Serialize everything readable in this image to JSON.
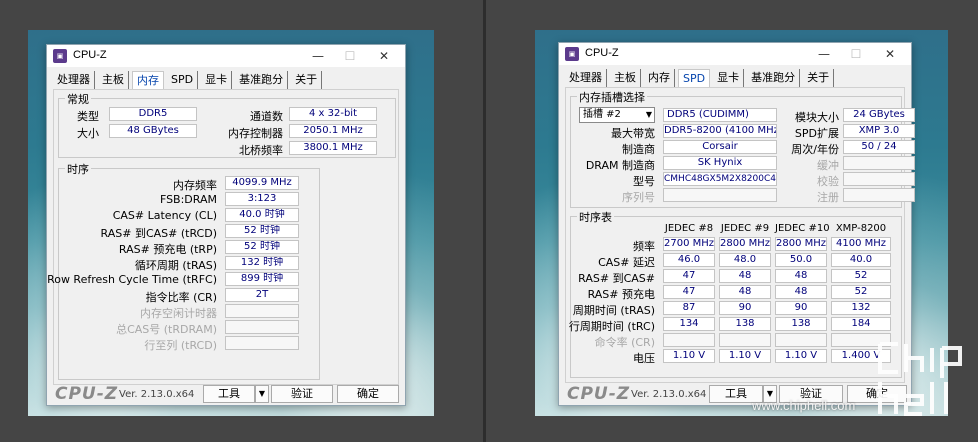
{
  "left": {
    "title": "CPU-Z",
    "tabs": [
      "处理器",
      "主板",
      "内存",
      "SPD",
      "显卡",
      "基准跑分",
      "关于"
    ],
    "active_tab": "内存",
    "general": {
      "group_label": "常规",
      "type_label": "类型",
      "type_value": "DDR5",
      "size_label": "大小",
      "size_value": "48 GBytes",
      "channels_label": "通道数",
      "channels_value": "4 x 32-bit",
      "mc_label": "内存控制器",
      "mc_value": "2050.1 MHz",
      "nb_label": "北桥频率",
      "nb_value": "3800.1 MHz"
    },
    "timing": {
      "group_label": "时序",
      "rows": [
        {
          "label": "内存频率",
          "value": "4099.9 MHz",
          "dim": false
        },
        {
          "label": "FSB:DRAM",
          "value": "3:123",
          "dim": false
        },
        {
          "label": "CAS# Latency (CL)",
          "value": "40.0 时钟",
          "dim": false
        },
        {
          "label": "RAS# 到CAS# (tRCD)",
          "value": "52 时钟",
          "dim": false
        },
        {
          "label": "RAS# 预充电 (tRP)",
          "value": "52 时钟",
          "dim": false
        },
        {
          "label": "循环周期 (tRAS)",
          "value": "132 时钟",
          "dim": false
        },
        {
          "label": "Row Refresh Cycle Time (tRFC)",
          "value": "899 时钟",
          "dim": false
        },
        {
          "label": "指令比率 (CR)",
          "value": "2T",
          "dim": false
        },
        {
          "label": "内存空闲计时器",
          "value": "",
          "dim": true
        },
        {
          "label": "总CAS号 (tRDRAM)",
          "value": "",
          "dim": true
        },
        {
          "label": "行至列 (tRCD)",
          "value": "",
          "dim": true
        }
      ]
    },
    "footer": {
      "brand": "CPU-Z",
      "version": "Ver. 2.13.0.x64",
      "tools": "工具",
      "validate": "验证",
      "ok": "确定"
    }
  },
  "right": {
    "title": "CPU-Z",
    "tabs": [
      "处理器",
      "主板",
      "内存",
      "SPD",
      "显卡",
      "基准跑分",
      "关于"
    ],
    "active_tab": "SPD",
    "slot": {
      "group_label": "内存插槽选择",
      "slot_value": "插槽 #2",
      "module_type": "DDR5 (CUDIMM)",
      "max_bw_label": "最大带宽",
      "max_bw_value": "DDR5-8200 (4100 MHz)",
      "mfr_label": "制造商",
      "mfr_value": "Corsair",
      "dram_mfr_label": "DRAM 制造商",
      "dram_mfr_value": "SK Hynix",
      "part_label": "型号",
      "part_value": "CMHC48GX5M2X8200C40",
      "serial_label": "序列号",
      "serial_value": "",
      "module_size_label": "模块大小",
      "module_size_value": "24 GBytes",
      "spd_ext_label": "SPD扩展",
      "spd_ext_value": "XMP 3.0",
      "week_year_label": "周次/年份",
      "week_year_value": "50 / 24",
      "buffered_label": "缓冲",
      "correction_label": "校验",
      "registered_label": "注册"
    },
    "timing_table": {
      "group_label": "时序表",
      "columns": [
        "JEDEC #8",
        "JEDEC #9",
        "JEDEC #10",
        "XMP-8200"
      ],
      "rows": [
        {
          "label": "频率",
          "values": [
            "2700 MHz",
            "2800 MHz",
            "2800 MHz",
            "4100 MHz"
          ],
          "dim": false
        },
        {
          "label": "CAS# 延迟",
          "values": [
            "46.0",
            "48.0",
            "50.0",
            "40.0"
          ],
          "dim": false
        },
        {
          "label": "RAS# 到CAS#",
          "values": [
            "47",
            "48",
            "48",
            "52"
          ],
          "dim": false
        },
        {
          "label": "RAS# 预充电",
          "values": [
            "47",
            "48",
            "48",
            "52"
          ],
          "dim": false
        },
        {
          "label": "周期时间 (tRAS)",
          "values": [
            "87",
            "90",
            "90",
            "132"
          ],
          "dim": false
        },
        {
          "label": "行周期时间 (tRC)",
          "values": [
            "134",
            "138",
            "138",
            "184"
          ],
          "dim": false
        },
        {
          "label": "命令率 (CR)",
          "values": [
            "",
            "",
            "",
            ""
          ],
          "dim": true
        },
        {
          "label": "电压",
          "values": [
            "1.10 V",
            "1.10 V",
            "1.10 V",
            "1.400 V"
          ],
          "dim": false
        }
      ]
    },
    "footer": {
      "brand": "CPU-Z",
      "version": "Ver. 2.13.0.x64",
      "tools": "工具",
      "validate": "验证",
      "ok": "确定"
    }
  },
  "watermark": {
    "logo": "chiphell",
    "url": "www.chiphell.com"
  }
}
